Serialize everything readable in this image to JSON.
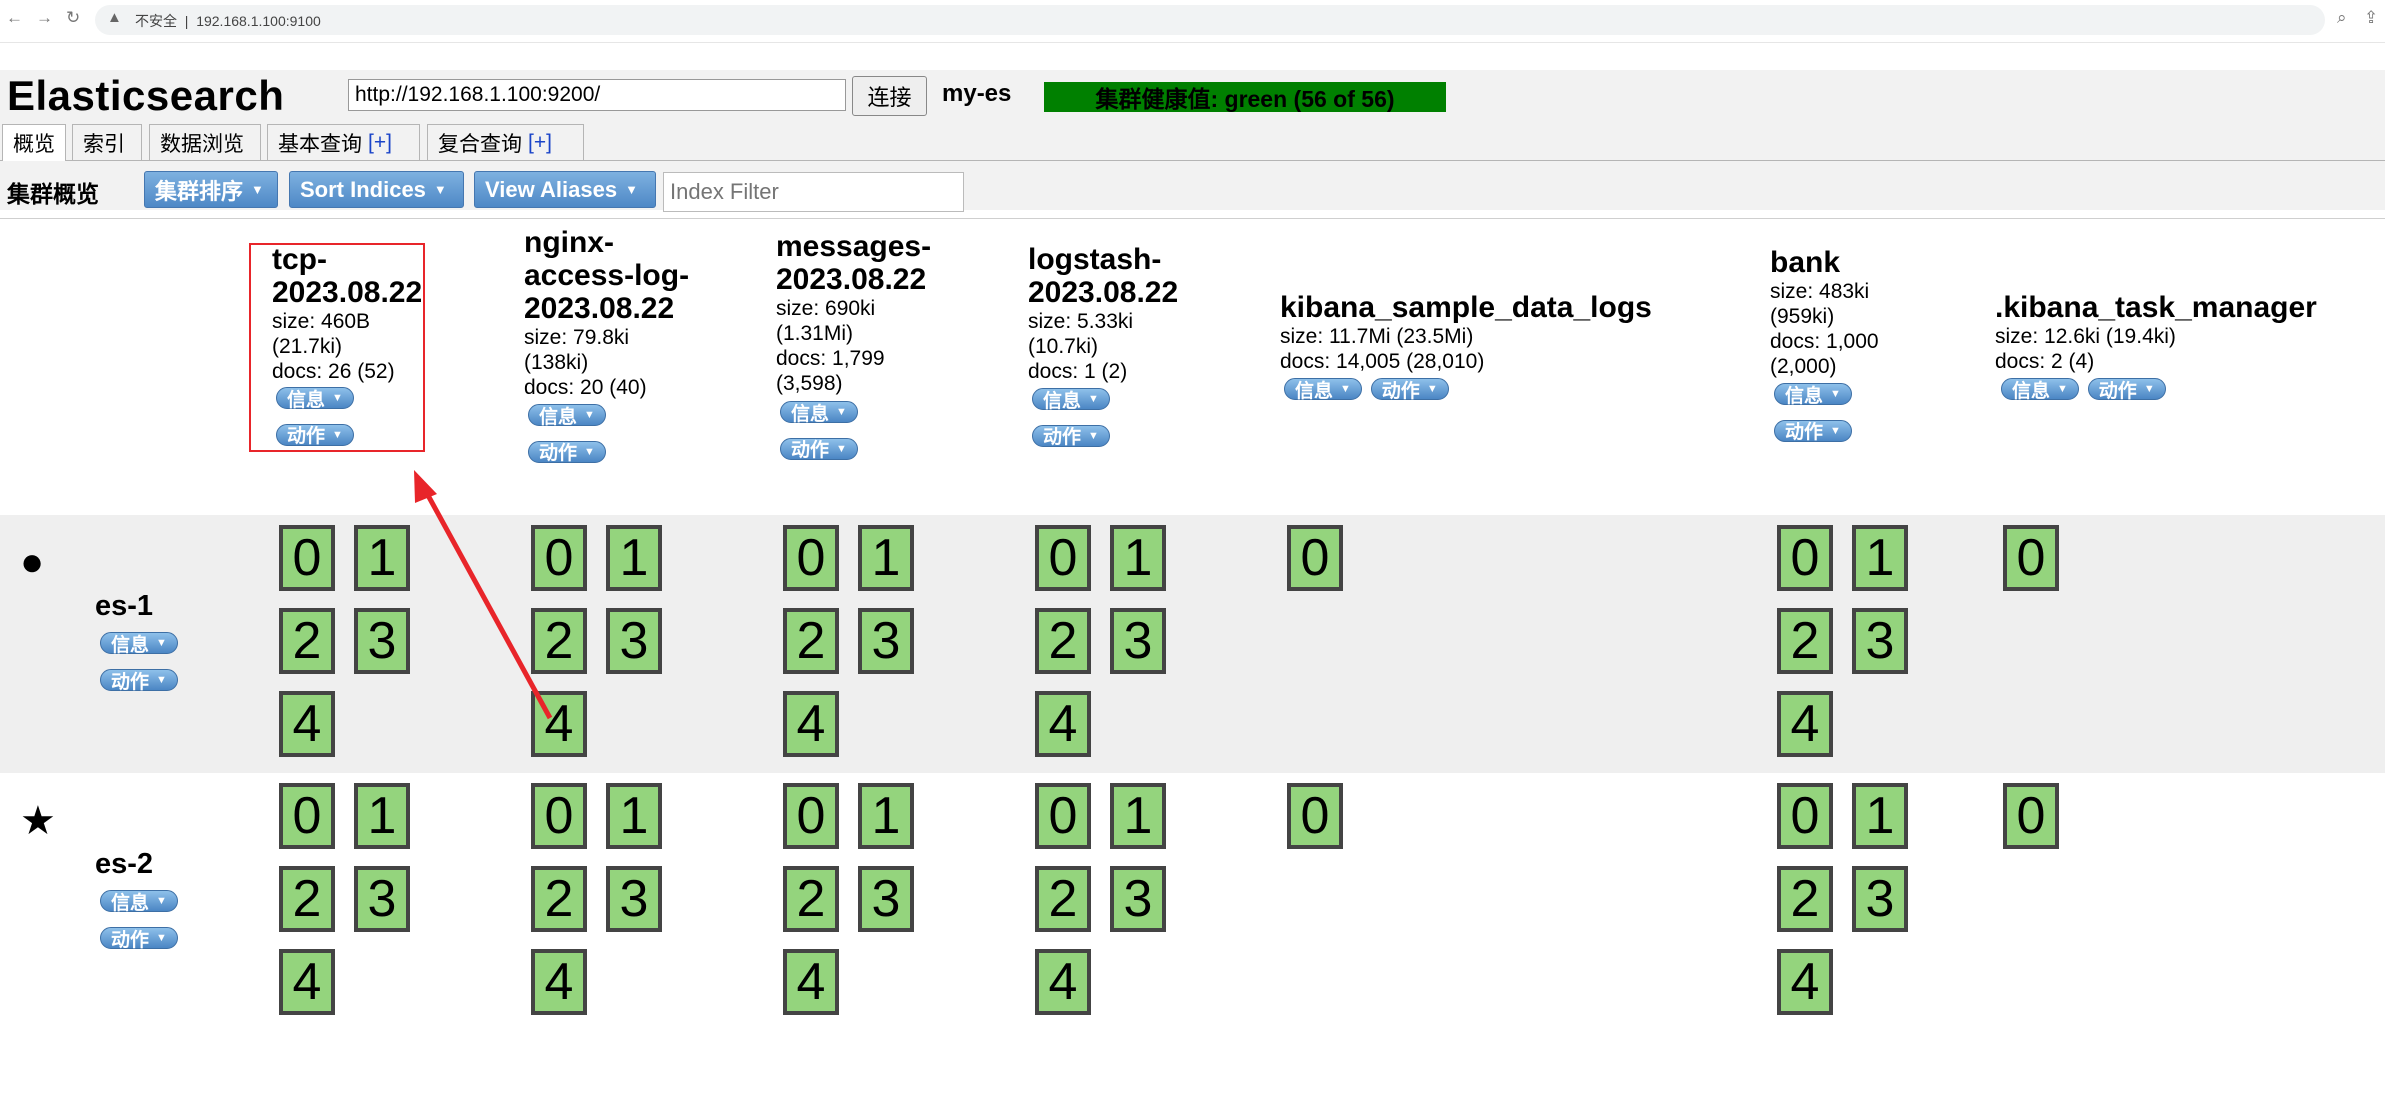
{
  "browser": {
    "back_icon": "arrow-left-icon",
    "security_label": "不安全",
    "url": "192.168.1.100:9100"
  },
  "app": {
    "title": "Elasticsearch",
    "es_url": "http://192.168.1.100:9200/",
    "connect_label": "连接",
    "cluster_name": "my-es",
    "health_text": "集群健康值: green (56 of 56)",
    "health_color": "#008000"
  },
  "tabs": [
    {
      "label": "概览",
      "plus": ""
    },
    {
      "label": "索引",
      "plus": ""
    },
    {
      "label": "数据浏览",
      "plus": ""
    },
    {
      "label": "基本查询",
      "plus": "[+]"
    },
    {
      "label": "复合查询",
      "plus": "[+]"
    }
  ],
  "toolbar": {
    "section_label": "集群概览",
    "sort_cluster_label": "集群排序",
    "sort_indices_label": "Sort Indices",
    "view_aliases_label": "View Aliases",
    "filter_placeholder": "Index Filter"
  },
  "pill_labels": {
    "info": "信息",
    "action": "动作"
  },
  "indices": [
    {
      "name": "tcp-\n2023.08.22",
      "size": "size: 460B\n(21.7ki)",
      "docs": "docs: 26 (52)"
    },
    {
      "name": "nginx-\naccess-log-\n2023.08.22",
      "size": "size: 79.8ki\n(138ki)",
      "docs": "docs: 20 (40)"
    },
    {
      "name": "messages-\n2023.08.22",
      "size": "size: 690ki\n(1.31Mi)",
      "docs": "docs: 1,799\n(3,598)"
    },
    {
      "name": "logstash-\n2023.08.22",
      "size": "size: 5.33ki\n(10.7ki)",
      "docs": "docs: 1 (2)"
    },
    {
      "name": "kibana_sample_data_logs",
      "size": "size: 11.7Mi (23.5Mi)",
      "docs": "docs: 14,005 (28,010)"
    },
    {
      "name": "bank",
      "size": "size: 483ki\n(959ki)",
      "docs": "docs: 1,000\n(2,000)"
    },
    {
      "name": ".kibana_task_manager",
      "size": "size: 12.6ki (19.4ki)",
      "docs": "docs: 2 (4)"
    }
  ],
  "nodes": [
    {
      "name": "es-1",
      "icon": "circle-icon",
      "glyph": "●"
    },
    {
      "name": "es-2",
      "icon": "star-icon",
      "glyph": "★"
    }
  ],
  "shard_colors": {
    "fill": "#94d47d",
    "border": "#444444"
  },
  "annotation_colors": {
    "highlight": "#e8252a"
  }
}
